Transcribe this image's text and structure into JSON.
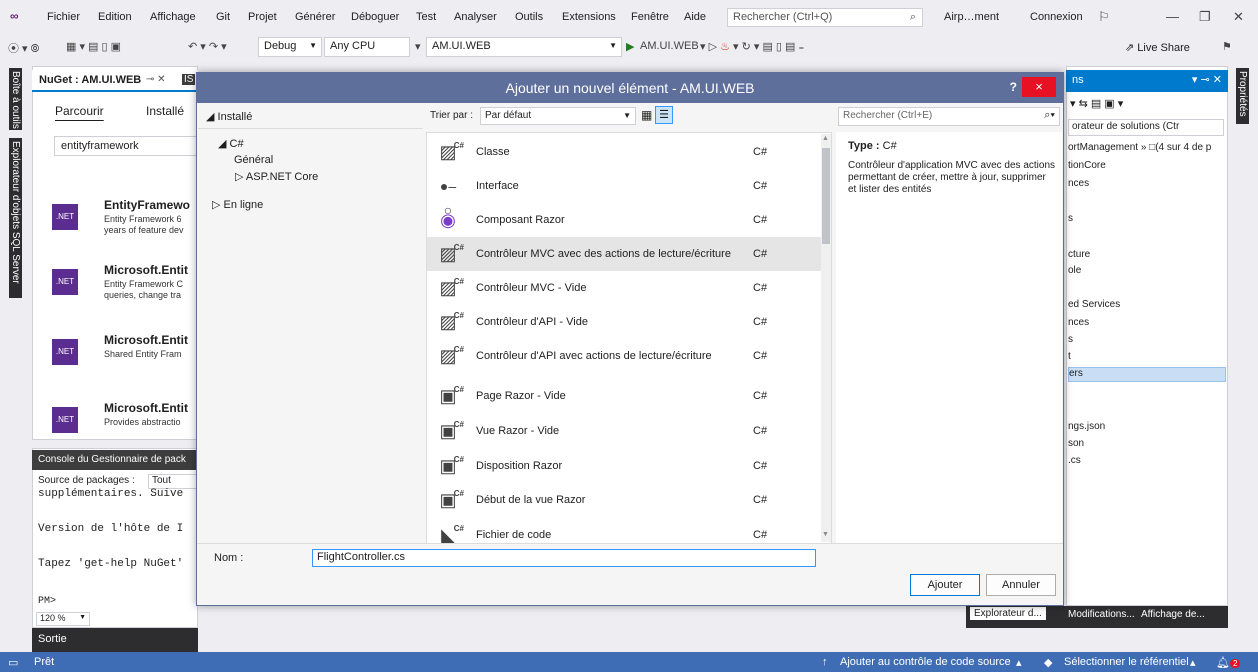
{
  "menubar": {
    "items": [
      "Fichier",
      "Edition",
      "Affichage",
      "Git",
      "Projet",
      "Générer",
      "Déboguer",
      "Test",
      "Analyser",
      "Outils",
      "Extensions",
      "Fenêtre",
      "Aide"
    ],
    "search_placeholder": "Rechercher (Ctrl+Q)",
    "project_short": "Airp…ment",
    "connexion": "Connexion"
  },
  "toolbar": {
    "config": "Debug",
    "platform": "Any CPU",
    "project": "AM.UI.WEB",
    "run_target": "AM.UI.WEB",
    "live_share": "Live Share"
  },
  "left_rail": {
    "tabs": [
      "Boîte à outils",
      "Explorateur d'objets SQL Server"
    ]
  },
  "right_rail": {
    "tabs": [
      "Propriétés"
    ]
  },
  "nuget": {
    "tab_title": "NuGet : AM.UI.WEB",
    "next_tab": "IS",
    "tabs": [
      "Parcourir",
      "Installé"
    ],
    "search_value": "entityframework",
    "packages": [
      {
        "icon": ".NET",
        "name": "EntityFramewo",
        "desc1": "Entity Framework 6",
        "desc2": "years of feature dev"
      },
      {
        "icon": ".NET",
        "name": "Microsoft.Entit",
        "desc1": "Entity Framework C",
        "desc2": "queries, change tra"
      },
      {
        "icon": ".NET",
        "name": "Microsoft.Entit",
        "desc1": "Shared Entity Fram",
        "desc2": ""
      },
      {
        "icon": ".NET",
        "name": "Microsoft.Entit",
        "desc1": "Provides abstractio",
        "desc2": ""
      }
    ]
  },
  "console": {
    "title": "Console du Gestionnaire de pack",
    "source_label": "Source de packages :",
    "source_value": "Tout",
    "lines": [
      "supplémentaires. Suive",
      "Version de l'hôte de I",
      "Tapez 'get-help NuGet'",
      "PM>"
    ],
    "zoom": "120 %",
    "output_tab": "Sortie"
  },
  "solution": {
    "title": "ns",
    "search": "orateur de solutions (Ctr",
    "lines": [
      "ortManagement » □(4 sur 4 de p",
      "tionCore",
      "nces",
      "s",
      "cture",
      "ole",
      "ed Services",
      "nces",
      "s",
      "t",
      "ers",
      "ngs.json",
      "son",
      ".cs"
    ],
    "bottom_tabs": [
      "Explorateur d...",
      "Modifications...",
      "Affichage de..."
    ]
  },
  "dialog": {
    "title": "Ajouter un nouvel élément - AM.UI.WEB",
    "help": "?",
    "close": "×",
    "tree": {
      "installed": "Installé",
      "csharp": "C#",
      "general": "Général",
      "aspnet": "ASP.NET Core",
      "online": "En ligne"
    },
    "sort_label": "Trier par :",
    "sort_value": "Par défaut",
    "search_placeholder": "Rechercher (Ctrl+E)",
    "items": [
      {
        "name": "Classe",
        "lang": "C#",
        "icon": "class-icon"
      },
      {
        "name": "Interface",
        "lang": "C#",
        "icon": "interface-icon"
      },
      {
        "name": "Composant Razor",
        "lang": "C#",
        "icon": "razor-component-icon"
      },
      {
        "name": "Contrôleur MVC avec des actions de lecture/écriture",
        "lang": "C#",
        "icon": "controller-icon"
      },
      {
        "name": "Contrôleur MVC - Vide",
        "lang": "C#",
        "icon": "controller-icon"
      },
      {
        "name": "Contrôleur d'API - Vide",
        "lang": "C#",
        "icon": "controller-icon"
      },
      {
        "name": "Contrôleur d'API avec actions de lecture/écriture",
        "lang": "C#",
        "icon": "controller-icon"
      },
      {
        "name": "Page Razor - Vide",
        "lang": "C#",
        "icon": "razor-page-icon"
      },
      {
        "name": "Vue Razor - Vide",
        "lang": "C#",
        "icon": "razor-page-icon"
      },
      {
        "name": "Disposition Razor",
        "lang": "C#",
        "icon": "razor-page-icon"
      },
      {
        "name": "Début de la vue Razor",
        "lang": "C#",
        "icon": "razor-page-icon"
      },
      {
        "name": "Fichier de code",
        "lang": "C#",
        "icon": "code-file-icon"
      }
    ],
    "selected_index": 3,
    "desc_type_label": "Type :",
    "desc_type_value": "C#",
    "description": "Contrôleur d'application MVC avec des actions permettant de créer, mettre à jour, supprimer et lister des entités",
    "name_label": "Nom :",
    "name_value": "FlightController.cs",
    "add_button": "Ajouter",
    "cancel_button": "Annuler"
  },
  "statusbar": {
    "ready": "Prêt",
    "add_source": "Ajouter au contrôle de code source",
    "select_repo": "Sélectionner le référentiel",
    "notifications": "2"
  }
}
